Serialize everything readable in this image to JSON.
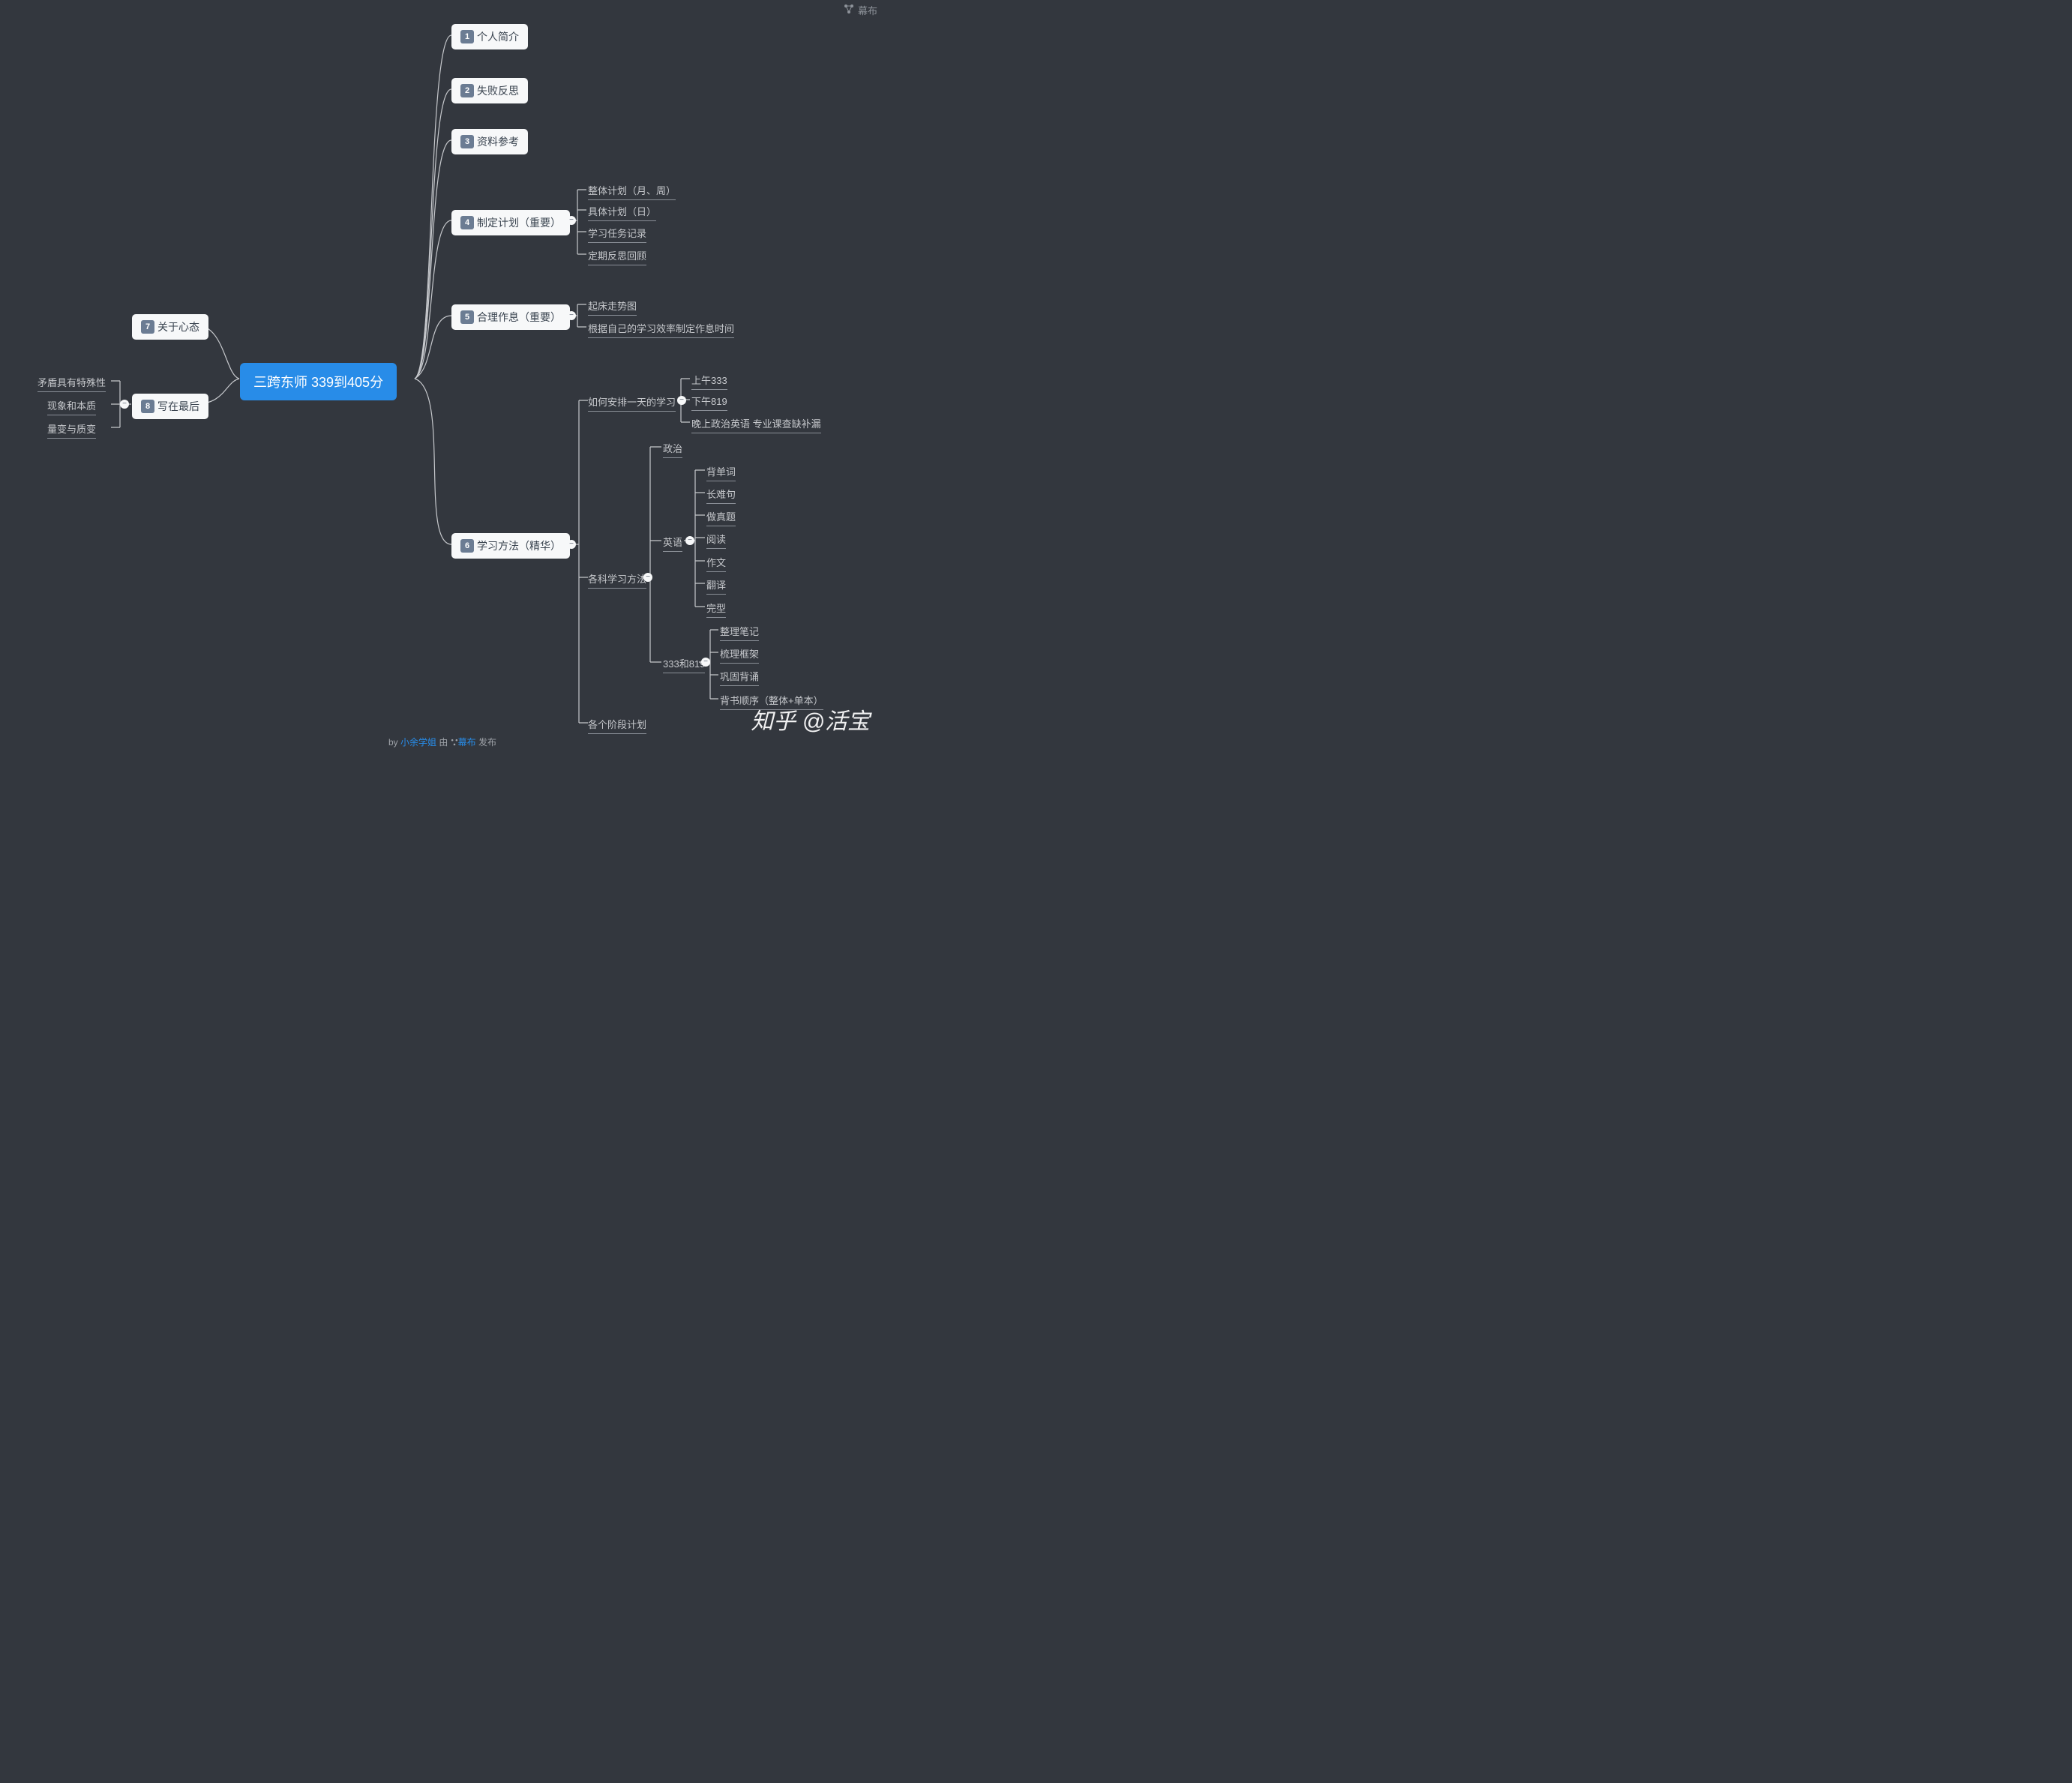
{
  "brand": "幕布",
  "root": "三跨东师 339到405分",
  "right": {
    "n1": {
      "num": "1",
      "label": "个人简介"
    },
    "n2": {
      "num": "2",
      "label": "失败反思"
    },
    "n3": {
      "num": "3",
      "label": "资料参考"
    },
    "n4": {
      "num": "4",
      "label": "制定计划（重要）",
      "c": [
        "整体计划（月、周）",
        "具体计划（日）",
        "学习任务记录",
        "定期反思回顾"
      ]
    },
    "n5": {
      "num": "5",
      "label": "合理作息（重要）",
      "c": [
        "起床走势图",
        "根据自己的学习效率制定作息时间"
      ]
    },
    "n6": {
      "num": "6",
      "label": "学习方法（精华）",
      "arrange": {
        "label": "如何安排一天的学习",
        "c": [
          "上午333",
          "下午819",
          "晚上政治英语 专业课查缺补漏"
        ]
      },
      "subjects": {
        "label": "各科学习方法",
        "pol": "政治",
        "eng": {
          "label": "英语",
          "c": [
            "背单词",
            "长难句",
            "做真题",
            "阅读",
            "作文",
            "翻译",
            "完型"
          ]
        },
        "pro": {
          "label": "333和819",
          "c": [
            "整理笔记",
            "梳理框架",
            "巩固背诵",
            "背书顺序（整体+单本）"
          ]
        }
      },
      "stage": "各个阶段计划"
    }
  },
  "left": {
    "n7": {
      "num": "7",
      "label": "关于心态"
    },
    "n8": {
      "num": "8",
      "label": "写在最后",
      "c": [
        "矛盾具有特殊性",
        "现象和本质",
        "量变与质变"
      ]
    }
  },
  "footer": {
    "by": "by ",
    "author": "小余学姐",
    "mid": " 由 ",
    "app": "幕布",
    "pub": " 发布"
  },
  "watermark": "知乎 @活宝"
}
